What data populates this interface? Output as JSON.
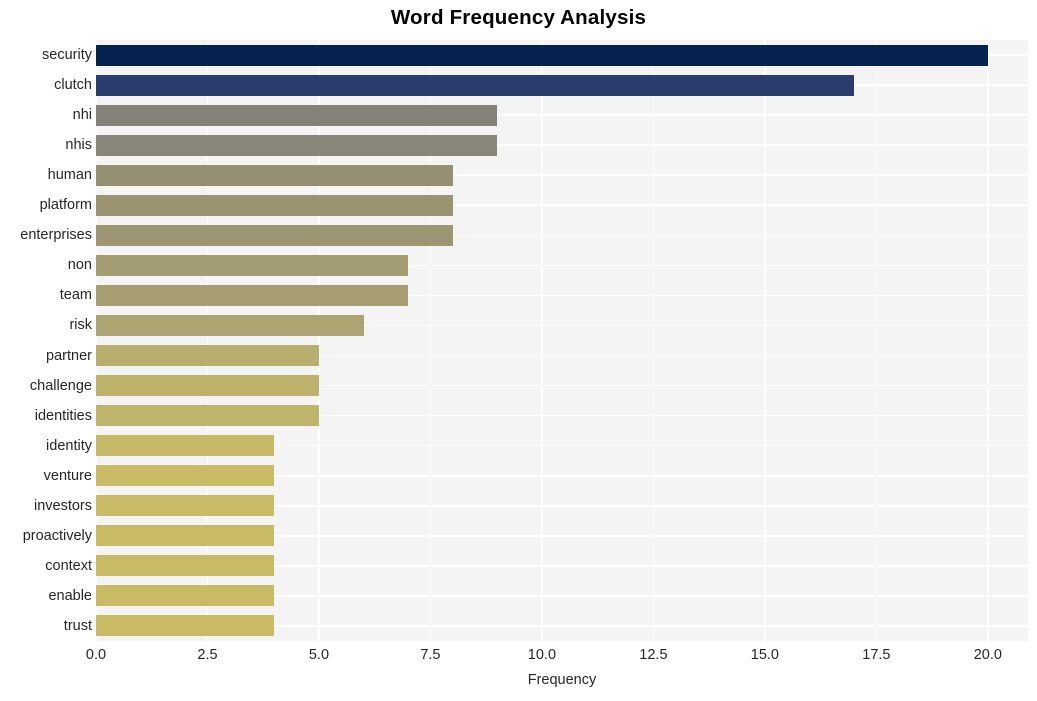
{
  "chart_data": {
    "type": "bar",
    "orientation": "horizontal",
    "title": "Word Frequency Analysis",
    "xlabel": "Frequency",
    "ylabel": "",
    "categories": [
      "security",
      "clutch",
      "nhi",
      "nhis",
      "human",
      "platform",
      "enterprises",
      "non",
      "team",
      "risk",
      "partner",
      "challenge",
      "identities",
      "identity",
      "venture",
      "investors",
      "proactively",
      "context",
      "enable",
      "trust"
    ],
    "values": [
      20,
      17,
      9,
      9,
      8,
      8,
      8,
      7,
      7,
      6,
      5,
      5,
      5,
      4,
      4,
      4,
      4,
      4,
      4,
      4
    ],
    "xlim": [
      0,
      20.9
    ],
    "xticks": [
      0.0,
      2.5,
      5.0,
      7.5,
      10.0,
      12.5,
      15.0,
      17.5,
      20.0
    ],
    "xtick_labels": [
      "0.0",
      "2.5",
      "5.0",
      "7.5",
      "10.0",
      "12.5",
      "15.0",
      "17.5",
      "20.0"
    ],
    "grid": true,
    "legend": false,
    "bar_colors": [
      "#062350",
      "#2b3d6e",
      "#848179",
      "#888579",
      "#958f73",
      "#9b9472",
      "#9d9672",
      "#a49c72",
      "#a69e72",
      "#aca473",
      "#b8ae6d",
      "#bcb26c",
      "#bfb46b",
      "#c6ba68",
      "#c9bb67",
      "#c9bb67",
      "#c9ba66",
      "#c9ba66",
      "#c9ba66",
      "#c9ba66"
    ],
    "style": {
      "plot_background": "#f4f4f4",
      "grid_color": "#ffffff",
      "figure_background": "#ffffff",
      "text_color": "#262626"
    }
  }
}
